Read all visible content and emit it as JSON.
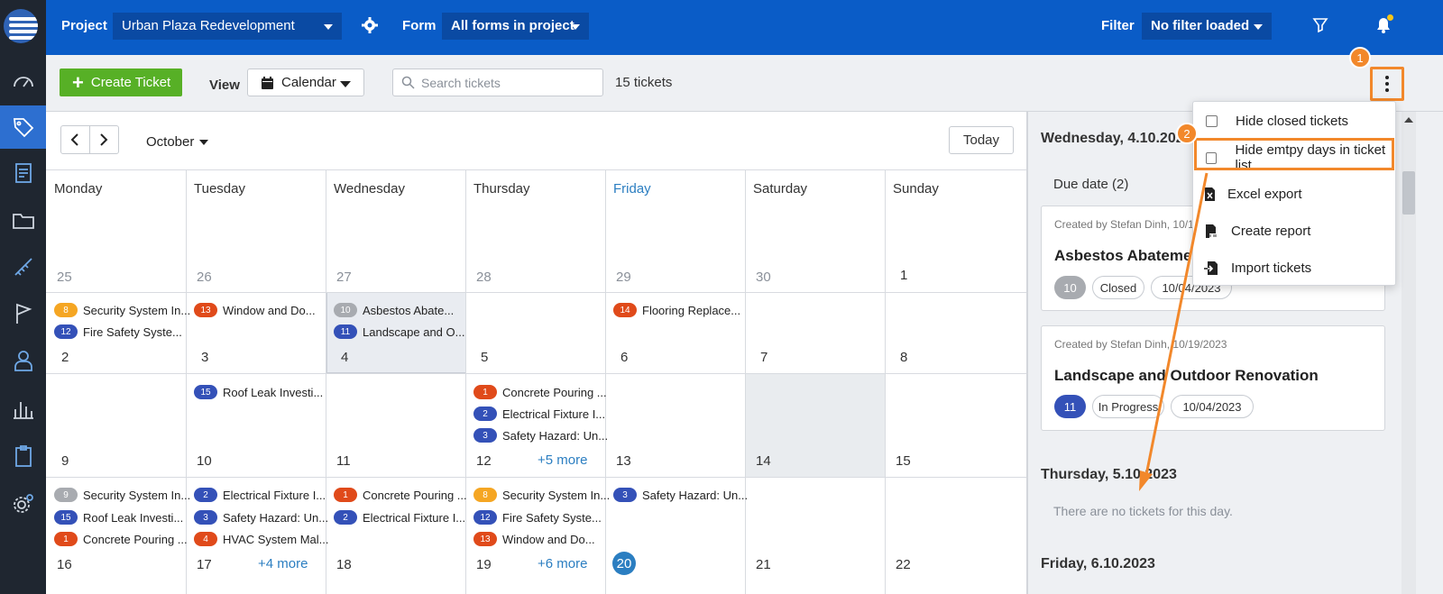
{
  "topbar": {
    "project_label": "Project",
    "project_value": "Urban Plaza Redevelopment",
    "form_label": "Form",
    "form_value": "All forms in project",
    "filter_label": "Filter",
    "filter_value": "No filter loaded"
  },
  "toolbar": {
    "create_label": "Create Ticket",
    "view_label": "View",
    "view_value": "Calendar",
    "search_placeholder": "Search tickets",
    "ticket_count": "15 tickets",
    "step1": "1",
    "step2": "2"
  },
  "calendar": {
    "month": "October",
    "today_label": "Today",
    "weekdays": [
      "Monday",
      "Tuesday",
      "Wednesday",
      "Thursday",
      "Friday",
      "Saturday",
      "Sunday"
    ],
    "weeks": [
      {
        "days": [
          "25",
          "26",
          "27",
          "28",
          "29",
          "30",
          "1"
        ]
      },
      {
        "days": [
          "2",
          "3",
          "4",
          "5",
          "6",
          "7",
          "8"
        ]
      },
      {
        "days": [
          "9",
          "10",
          "11",
          "12",
          "13",
          "14",
          "15"
        ]
      },
      {
        "days": [
          "16",
          "17",
          "18",
          "19",
          "20",
          "21",
          "22"
        ]
      }
    ],
    "events": {
      "mon2": [
        {
          "num": "8",
          "title": "Security System In..."
        },
        {
          "num": "12",
          "title": "Fire Safety Syste..."
        }
      ],
      "tue3": [
        {
          "num": "13",
          "title": "Window and Do..."
        }
      ],
      "wed4": [
        {
          "num": "10",
          "title": "Asbestos Abate..."
        },
        {
          "num": "11",
          "title": "Landscape and O..."
        }
      ],
      "fri6": [
        {
          "num": "14",
          "title": "Flooring Replace..."
        }
      ],
      "tue10": [
        {
          "num": "15",
          "title": "Roof Leak Investi..."
        }
      ],
      "thu12": [
        {
          "num": "1",
          "title": "Concrete Pouring ..."
        },
        {
          "num": "2",
          "title": "Electrical Fixture I..."
        },
        {
          "num": "3",
          "title": "Safety Hazard: Un..."
        }
      ],
      "mon16": [
        {
          "num": "9",
          "title": "Security System In..."
        },
        {
          "num": "15",
          "title": "Roof Leak Investi..."
        },
        {
          "num": "1",
          "title": "Concrete Pouring ..."
        }
      ],
      "tue17": [
        {
          "num": "2",
          "title": "Electrical Fixture I..."
        },
        {
          "num": "3",
          "title": "Safety Hazard: Un..."
        },
        {
          "num": "4",
          "title": "HVAC System Mal..."
        }
      ],
      "wed18": [
        {
          "num": "1",
          "title": "Concrete Pouring ..."
        },
        {
          "num": "2",
          "title": "Electrical Fixture I..."
        }
      ],
      "thu19": [
        {
          "num": "8",
          "title": "Security System In..."
        },
        {
          "num": "12",
          "title": "Fire Safety Syste..."
        },
        {
          "num": "13",
          "title": "Window and Do..."
        }
      ],
      "fri20": [
        {
          "num": "3",
          "title": "Safety Hazard: Un..."
        }
      ]
    },
    "more": {
      "thu12": "+5 more",
      "tue17": "+4 more",
      "thu19": "+6 more"
    }
  },
  "panel": {
    "day1_title": "Wednesday, 4.10.2023",
    "due_label": "Due date (2)",
    "card1": {
      "meta": "Created by Stefan Dinh, 10/1",
      "title": "Asbestos Abatement",
      "num": "10",
      "status": "Closed",
      "date": "10/04/2023"
    },
    "card2": {
      "meta": "Created by Stefan Dinh, 10/19/2023",
      "title": "Landscape and Outdoor Renovation",
      "num": "11",
      "status": "In Progress",
      "date": "10/04/2023"
    },
    "day2_title": "Thursday, 5.10.2023",
    "day2_empty": "There are no tickets for this day.",
    "day3_title": "Friday, 6.10.2023"
  },
  "menu": {
    "hide_closed": "Hide closed tickets",
    "hide_empty": "Hide emtpy days in ticket list",
    "excel_export": "Excel export",
    "create_report": "Create report",
    "import_tickets": "Import tickets"
  },
  "colors": {
    "topbar": "#0a5cc7",
    "accent_orange": "#f2882b",
    "create_green": "#57b026",
    "today_blue": "#2b7ec1",
    "pill_yellow": "#f5a623",
    "pill_blue": "#3451b8",
    "pill_red": "#e04a1a",
    "pill_grey": "#a8abb0"
  }
}
